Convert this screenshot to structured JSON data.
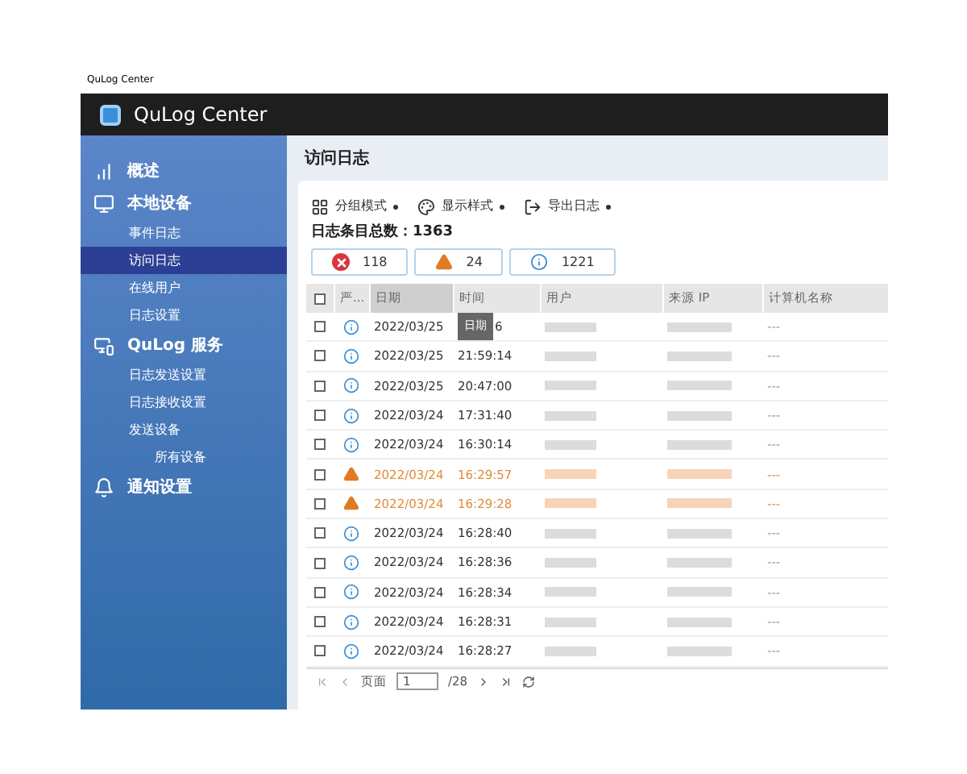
{
  "window": {
    "title": "QuLog Center"
  },
  "app_header": {
    "title": "QuLog Center"
  },
  "sidebar": {
    "items": [
      {
        "label": "概述",
        "selected": false
      },
      {
        "label": "本地设备",
        "selected": false,
        "children": [
          {
            "label": "事件日志",
            "selected": false
          },
          {
            "label": "访问日志",
            "selected": true
          },
          {
            "label": "在线用户",
            "selected": false
          },
          {
            "label": "日志设置",
            "selected": false
          }
        ]
      },
      {
        "label": "QuLog 服务",
        "selected": false,
        "children": [
          {
            "label": "日志发送设置",
            "selected": false
          },
          {
            "label": "日志接收设置",
            "selected": false
          },
          {
            "label": "发送设备",
            "selected": false,
            "children": [
              {
                "label": "所有设备",
                "selected": false
              }
            ]
          }
        ]
      },
      {
        "label": "通知设置",
        "selected": false
      }
    ]
  },
  "page_title": "访问日志",
  "toolbar": [
    {
      "label": "分组模式"
    },
    {
      "label": "显示样式"
    },
    {
      "label": "导出日志"
    }
  ],
  "total": {
    "label": "日志条目总数：",
    "value": "1363"
  },
  "filters": [
    {
      "kind": "error",
      "count": "118"
    },
    {
      "kind": "warning",
      "count": "24"
    },
    {
      "kind": "info",
      "count": "1221"
    }
  ],
  "table": {
    "all_checked": false,
    "columns": [
      {
        "label": "严...",
        "sorted": false
      },
      {
        "label": "日期",
        "sorted": true
      },
      {
        "label": "时间",
        "sorted": false
      },
      {
        "label": "用户",
        "sorted": false
      },
      {
        "label": "来源 IP",
        "sorted": false
      },
      {
        "label": "计算机名称",
        "sorted": false
      }
    ],
    "rows": [
      {
        "kind": "info",
        "checked": false,
        "date": "2022/03/25",
        "tooltip": "日期",
        "time": "6",
        "computer": "---"
      },
      {
        "kind": "info",
        "checked": false,
        "date": "2022/03/25",
        "time": "21:59:14",
        "computer": "---"
      },
      {
        "kind": "info",
        "checked": false,
        "date": "2022/03/25",
        "time": "20:47:00",
        "computer": "---"
      },
      {
        "kind": "info",
        "checked": false,
        "date": "2022/03/24",
        "time": "17:31:40",
        "computer": "---"
      },
      {
        "kind": "info",
        "checked": false,
        "date": "2022/03/24",
        "time": "16:30:14",
        "computer": "---"
      },
      {
        "kind": "warning",
        "checked": false,
        "date": "2022/03/24",
        "time": "16:29:57",
        "computer": "---"
      },
      {
        "kind": "warning",
        "checked": false,
        "date": "2022/03/24",
        "time": "16:29:28",
        "computer": "---"
      },
      {
        "kind": "info",
        "checked": false,
        "date": "2022/03/24",
        "time": "16:28:40",
        "computer": "---"
      },
      {
        "kind": "info",
        "checked": false,
        "date": "2022/03/24",
        "time": "16:28:36",
        "computer": "---"
      },
      {
        "kind": "info",
        "checked": false,
        "date": "2022/03/24",
        "time": "16:28:34",
        "computer": "---"
      },
      {
        "kind": "info",
        "checked": false,
        "date": "2022/03/24",
        "time": "16:28:31",
        "computer": "---"
      },
      {
        "kind": "info",
        "checked": false,
        "date": "2022/03/24",
        "time": "16:28:27",
        "computer": "---"
      }
    ]
  },
  "pagination": {
    "label": "页面",
    "page": "1",
    "total": "/28"
  }
}
